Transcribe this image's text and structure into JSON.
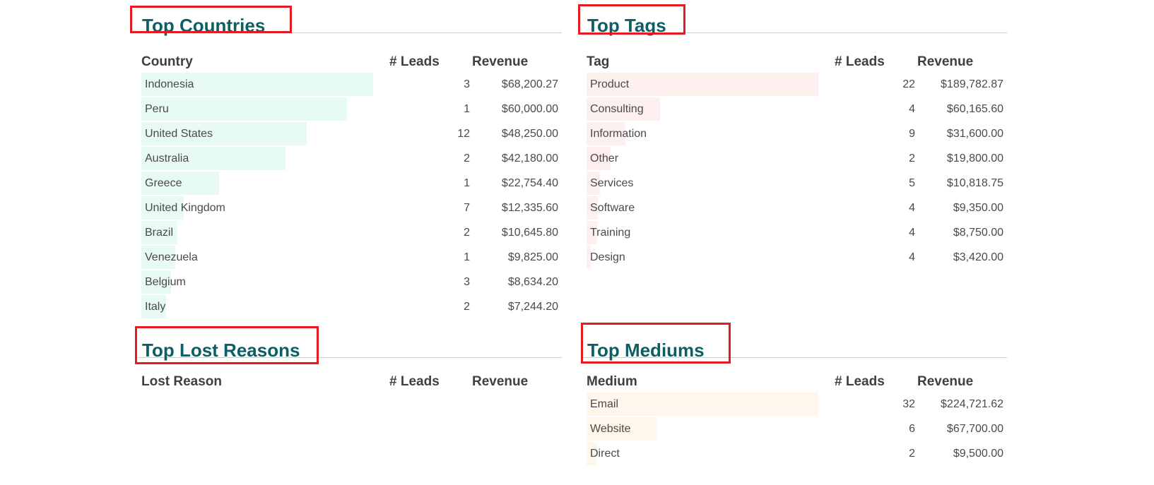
{
  "panels": {
    "countries": {
      "title": "Top Countries",
      "headers": {
        "name": "Country",
        "leads": "# Leads",
        "revenue": "Revenue"
      },
      "bar_color": "#e8fbf2",
      "rows": [
        {
          "name": "Indonesia",
          "leads": "3",
          "revenue": "$68,200.27",
          "share": 1.0
        },
        {
          "name": "Peru",
          "leads": "1",
          "revenue": "$60,000.00",
          "share": 0.886
        },
        {
          "name": "United States",
          "leads": "12",
          "revenue": "$48,250.00",
          "share": 0.712
        },
        {
          "name": "Australia",
          "leads": "2",
          "revenue": "$42,180.00",
          "share": 0.622
        },
        {
          "name": "Greece",
          "leads": "1",
          "revenue": "$22,754.40",
          "share": 0.336
        },
        {
          "name": "United Kingdom",
          "leads": "7",
          "revenue": "$12,335.60",
          "share": 0.182
        },
        {
          "name": "Brazil",
          "leads": "2",
          "revenue": "$10,645.80",
          "share": 0.157
        },
        {
          "name": "Venezuela",
          "leads": "1",
          "revenue": "$9,825.00",
          "share": 0.145
        },
        {
          "name": "Belgium",
          "leads": "3",
          "revenue": "$8,634.20",
          "share": 0.127
        },
        {
          "name": "Italy",
          "leads": "2",
          "revenue": "$7,244.20",
          "share": 0.107
        }
      ]
    },
    "tags": {
      "title": "Top Tags",
      "headers": {
        "name": "Tag",
        "leads": "# Leads",
        "revenue": "Revenue"
      },
      "bar_color": "#fff0f0",
      "rows": [
        {
          "name": "Product",
          "leads": "22",
          "revenue": "$189,782.87",
          "share": 1.0
        },
        {
          "name": "Consulting",
          "leads": "4",
          "revenue": "$60,165.60",
          "share": 0.317
        },
        {
          "name": "Information",
          "leads": "9",
          "revenue": "$31,600.00",
          "share": 0.167
        },
        {
          "name": "Other",
          "leads": "2",
          "revenue": "$19,800.00",
          "share": 0.104
        },
        {
          "name": "Services",
          "leads": "5",
          "revenue": "$10,818.75",
          "share": 0.057
        },
        {
          "name": "Software",
          "leads": "4",
          "revenue": "$9,350.00",
          "share": 0.049
        },
        {
          "name": "Training",
          "leads": "4",
          "revenue": "$8,750.00",
          "share": 0.046
        },
        {
          "name": "Design",
          "leads": "4",
          "revenue": "$3,420.00",
          "share": 0.018
        }
      ]
    },
    "lost_reasons": {
      "title": "Top Lost Reasons",
      "headers": {
        "name": "Lost Reason",
        "leads": "# Leads",
        "revenue": "Revenue"
      },
      "bar_color": "#f0f0f0",
      "rows": []
    },
    "mediums": {
      "title": "Top Mediums",
      "headers": {
        "name": "Medium",
        "leads": "# Leads",
        "revenue": "Revenue"
      },
      "bar_color": "#fff6ec",
      "rows": [
        {
          "name": "Email",
          "leads": "32",
          "revenue": "$224,721.62",
          "share": 1.0
        },
        {
          "name": "Website",
          "leads": "6",
          "revenue": "$67,700.00",
          "share": 0.301
        },
        {
          "name": "Direct",
          "leads": "2",
          "revenue": "$9,500.00",
          "share": 0.042
        }
      ]
    }
  },
  "highlight_color": "#e31b23"
}
